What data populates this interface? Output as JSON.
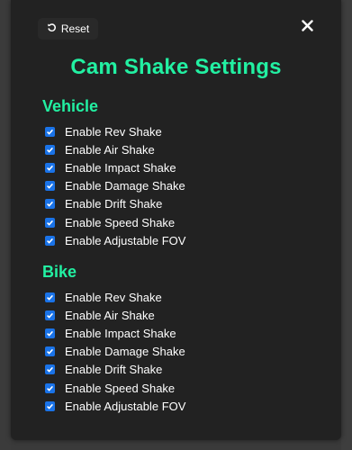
{
  "header": {
    "reset_label": "Reset",
    "close_icon": "close-icon",
    "reset_icon": "rotate-ccw-icon"
  },
  "title": "Cam Shake Settings",
  "colors": {
    "accent": "#22f0a2",
    "panel_bg": "#222222",
    "checkbox": "#1a73e8"
  },
  "sections": [
    {
      "title": "Vehicle",
      "options": [
        {
          "label": "Enable Rev Shake",
          "checked": true
        },
        {
          "label": "Enable Air Shake",
          "checked": true
        },
        {
          "label": "Enable Impact Shake",
          "checked": true
        },
        {
          "label": "Enable Damage Shake",
          "checked": true
        },
        {
          "label": "Enable Drift Shake",
          "checked": true
        },
        {
          "label": "Enable Speed Shake",
          "checked": true
        },
        {
          "label": "Enable Adjustable FOV",
          "checked": true
        }
      ]
    },
    {
      "title": "Bike",
      "options": [
        {
          "label": "Enable Rev Shake",
          "checked": true
        },
        {
          "label": "Enable Air Shake",
          "checked": true
        },
        {
          "label": "Enable Impact Shake",
          "checked": true
        },
        {
          "label": "Enable Damage Shake",
          "checked": true
        },
        {
          "label": "Enable Drift Shake",
          "checked": true
        },
        {
          "label": "Enable Speed Shake",
          "checked": true
        },
        {
          "label": "Enable Adjustable FOV",
          "checked": true
        }
      ]
    }
  ]
}
